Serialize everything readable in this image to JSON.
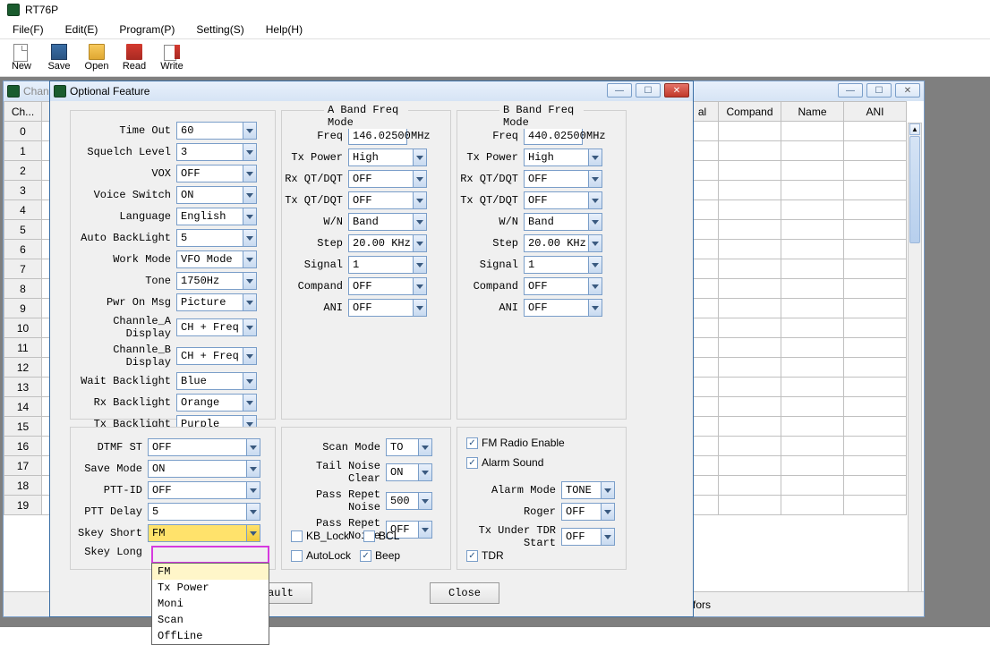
{
  "app": {
    "title": "RT76P"
  },
  "menu": {
    "file": "File(F)",
    "edit": "Edit(E)",
    "program": "Program(P)",
    "setting": "Setting(S)",
    "help": "Help(H)"
  },
  "tools": {
    "new": "New",
    "save": "Save",
    "open": "Open",
    "read": "Read",
    "write": "Write"
  },
  "chwin": {
    "title": "Chan",
    "headers": {
      "ch": "Ch...",
      "al": "al",
      "compand": "Compand",
      "name": "Name",
      "ani": "ANI"
    },
    "rows": [
      "0",
      "1",
      "2",
      "3",
      "4",
      "5",
      "6",
      "7",
      "8",
      "9",
      "10",
      "11",
      "12",
      "13",
      "14",
      "15",
      "16",
      "17",
      "18",
      "19"
    ],
    "bottom": "mfors"
  },
  "opt": {
    "title": "Optional Feature",
    "left": {
      "time_out": {
        "l": "Time Out",
        "v": "60"
      },
      "squelch": {
        "l": "Squelch Level",
        "v": "3"
      },
      "vox": {
        "l": "VOX",
        "v": "OFF"
      },
      "voice": {
        "l": "Voice Switch",
        "v": "ON"
      },
      "lang": {
        "l": "Language",
        "v": "English"
      },
      "autobl": {
        "l": "Auto BackLight",
        "v": "5"
      },
      "work": {
        "l": "Work Mode",
        "v": "VFO Mode"
      },
      "tone": {
        "l": "Tone",
        "v": "1750Hz"
      },
      "pwron": {
        "l": "Pwr On Msg",
        "v": "Picture"
      },
      "cha": {
        "l": "Channle_A Display",
        "v": "CH + Freq"
      },
      "chb": {
        "l": "Channle_B Display",
        "v": "CH + Freq"
      },
      "waitbl": {
        "l": "Wait Backlight",
        "v": "Blue"
      },
      "rxbl": {
        "l": "Rx Backlight",
        "v": "Orange"
      },
      "txbl": {
        "l": "Tx Backlight",
        "v": "Purple"
      }
    },
    "bandA": {
      "title": "A Band Freq Mode",
      "freq": {
        "l": "Freq",
        "v": "146.02500",
        "u": "MHz"
      },
      "txpower": {
        "l": "Tx Power",
        "v": "High"
      },
      "rxqt": {
        "l": "Rx QT/DQT",
        "v": "OFF"
      },
      "txqt": {
        "l": "Tx QT/DQT",
        "v": "OFF"
      },
      "wn": {
        "l": "W/N",
        "v": "Band"
      },
      "step": {
        "l": "Step",
        "v": "20.00 KHz"
      },
      "signal": {
        "l": "Signal",
        "v": "1"
      },
      "compand": {
        "l": "Compand",
        "v": "OFF"
      },
      "ani": {
        "l": "ANI",
        "v": "OFF"
      }
    },
    "bandB": {
      "title": "B Band Freq Mode",
      "freq": {
        "l": "Freq",
        "v": "440.02500",
        "u": "MHz"
      },
      "txpower": {
        "l": "Tx Power",
        "v": "High"
      },
      "rxqt": {
        "l": "Rx QT/DQT",
        "v": "OFF"
      },
      "txqt": {
        "l": "Tx QT/DQT",
        "v": "OFF"
      },
      "wn": {
        "l": "W/N",
        "v": "Band"
      },
      "step": {
        "l": "Step",
        "v": "20.00 KHz"
      },
      "signal": {
        "l": "Signal",
        "v": "1"
      },
      "compand": {
        "l": "Compand",
        "v": "OFF"
      },
      "ani": {
        "l": "ANI",
        "v": "OFF"
      }
    },
    "bot_left": {
      "dtmf": {
        "l": "DTMF ST",
        "v": "OFF"
      },
      "save": {
        "l": "Save Mode",
        "v": "ON"
      },
      "pttid": {
        "l": "PTT-ID",
        "v": "OFF"
      },
      "pttdelay": {
        "l": "PTT Delay",
        "v": "5"
      },
      "skshort": {
        "l": "Skey Short",
        "v": "FM"
      },
      "sklong": {
        "l": "Skey Long",
        "v": ""
      }
    },
    "bot_mid": {
      "scanmode": {
        "l": "Scan Mode",
        "v": "TO"
      },
      "tnc": {
        "l": "Tail Noise Clear",
        "v": "ON"
      },
      "prn1": {
        "l": "Pass Repet Noise",
        "v": "500"
      },
      "prn2": {
        "l": "Pass Repet Noise",
        "v": "OFF"
      },
      "kblock": "KB_Lock",
      "bcl": "BCL",
      "autolock": "AutoLock",
      "beep": "Beep"
    },
    "bot_right": {
      "fmradio": "FM Radio Enable",
      "alarmsound": "Alarm Sound",
      "alarmmode": {
        "l": "Alarm Mode",
        "v": "TONE"
      },
      "roger": {
        "l": "Roger",
        "v": "OFF"
      },
      "txtdr": {
        "l": "Tx Under TDR Start",
        "v": "OFF"
      },
      "tdr": "TDR"
    },
    "dropdown": {
      "items": [
        "FM",
        "Tx Power",
        "Moni",
        "Scan",
        "OffLine"
      ]
    },
    "default": "ault",
    "close": "Close"
  }
}
